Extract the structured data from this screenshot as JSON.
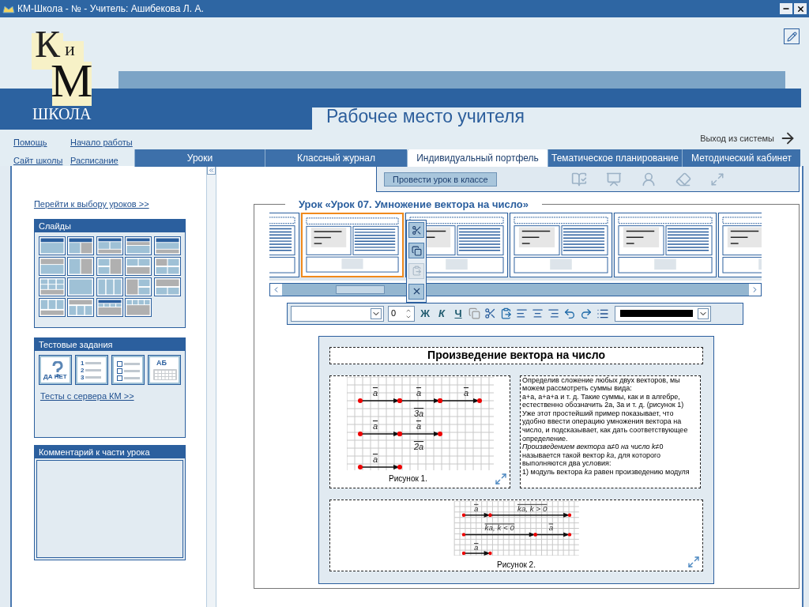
{
  "window": {
    "title": "КМ-Школа -  №  - Учитель: Ашибекова Л. А."
  },
  "logo": {
    "letters": [
      "К",
      "и",
      "М"
    ],
    "wordmark": "ШКОЛА"
  },
  "header": {
    "title": "Рабочее место учителя",
    "exit": "Выход из системы"
  },
  "links": [
    {
      "label": "Помощь"
    },
    {
      "label": "Начало работы"
    },
    {
      "label": "Сайт школы"
    },
    {
      "label": "Расписание"
    }
  ],
  "tabs": [
    {
      "label": "Уроки",
      "selected": false
    },
    {
      "label": "Классный журнал",
      "selected": false
    },
    {
      "label": "Индивидуальный портфель",
      "selected": true
    },
    {
      "label": "Тематическое планирование",
      "selected": false
    },
    {
      "label": "Методический кабинет",
      "selected": false
    }
  ],
  "sidebar": {
    "lessons_link": "Перейти к выбору уроков >>",
    "slides_panel": {
      "title": "Слайды"
    },
    "tests_panel": {
      "title": "Тестовые задания",
      "types": [
        {
          "kind": "yes-no",
          "marks": [
            "ДА",
            "НЕТ"
          ]
        },
        {
          "kind": "numbered",
          "marks": [
            "1",
            "2",
            "3"
          ]
        },
        {
          "kind": "checklist"
        },
        {
          "kind": "typing",
          "marks": [
            "АБ"
          ]
        }
      ],
      "link": "Тесты с сервера КМ >>"
    },
    "comment_panel": {
      "title": "Комментарий к части урока"
    }
  },
  "toolbar": {
    "run_button": "Провести урок в классе"
  },
  "lesson": {
    "title": "Урок «Урок 07. Умножение вектора на число»",
    "thumbnails": [
      {
        "selected": false
      },
      {
        "selected": true
      },
      {
        "selected": false
      },
      {
        "selected": false
      },
      {
        "selected": false
      },
      {
        "selected": false
      }
    ],
    "thumb_tools": [
      {
        "kind": "cut",
        "disabled": false
      },
      {
        "kind": "copy",
        "disabled": false
      },
      {
        "kind": "paste",
        "disabled": true
      },
      {
        "kind": "delete",
        "disabled": false
      }
    ]
  },
  "format_toolbar": {
    "size": "0",
    "style_buttons": [
      {
        "kind": "bold",
        "label": "Ж"
      },
      {
        "kind": "italic",
        "label": "К"
      },
      {
        "kind": "underline",
        "label": "Ч"
      }
    ],
    "color": "#000000"
  },
  "slide": {
    "title": "Произведение вектора на число",
    "figure_1": {
      "caption": "Рисунок 1.",
      "labels": [
        "a",
        "a",
        "a",
        "3a",
        "a",
        "a",
        "2a",
        "a"
      ]
    },
    "text": [
      "Определив сложение любых двух векторов, мы можем рассмотреть суммы вида:",
      "a+a, a+a+a и т. д. Такие суммы, как и в алгебре, естественно обозначить 2a, 3a и т. д. (рисунок 1)",
      "Уже этот простейший пример показывает, что удобно ввести операцию умножения вектора на число, и подсказывает, как дать соответствующее определение.",
      "*Произведением вектора* a≠0 *на число k*≠0 называется такой вектор *ka*, для которого выполняются два условия:",
      "1) модуль вектора *ka* равен произведению модуля"
    ],
    "figure_2": {
      "caption": "Рисунок 2.",
      "labels": [
        "a",
        "ka, k > 0",
        "ka, k < 0",
        "a",
        "a"
      ]
    }
  }
}
